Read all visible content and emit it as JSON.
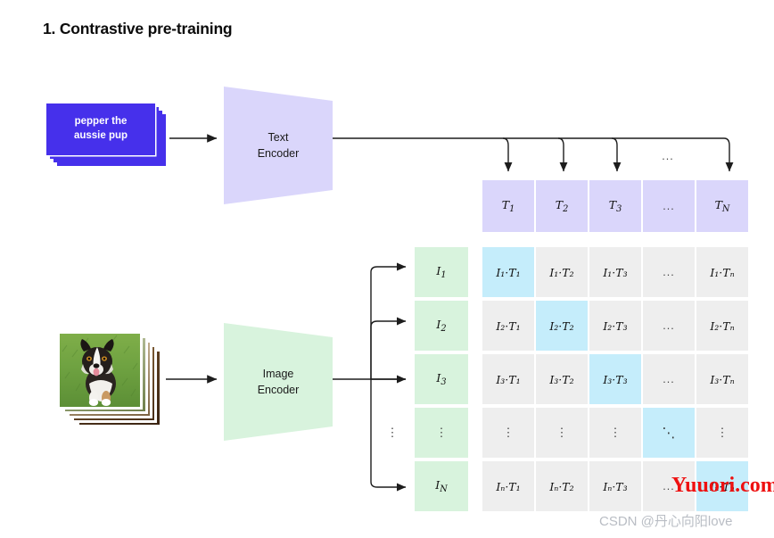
{
  "title": "1. Contrastive pre-training",
  "text_input": {
    "caption": "pepper the\naussie pup",
    "stack_count": 4
  },
  "image_input": {
    "alt": "photo of an aussie pup on grass",
    "stack_count": 5
  },
  "encoders": {
    "text": "Text\nEncoder",
    "image": "Image\nEncoder"
  },
  "text_embeddings": {
    "labels": [
      "T",
      "T",
      "T",
      "",
      "T"
    ],
    "subs": [
      "1",
      "2",
      "3",
      "",
      "N"
    ],
    "ellipsis": "...",
    "bus_ellipsis": "..."
  },
  "image_embeddings": {
    "labels": [
      "I",
      "I",
      "I",
      "",
      "I"
    ],
    "subs": [
      "1",
      "2",
      "3",
      "",
      "N"
    ],
    "ellipsis": "⋮"
  },
  "matrix": {
    "row_labels": [
      "I1",
      "I2",
      "I3",
      "vdots",
      "IN"
    ],
    "col_labels": [
      "T1",
      "T2",
      "T3",
      "dots",
      "TN"
    ],
    "cells": [
      [
        "I₁·T₁",
        "I₁·T₂",
        "I₁·T₃",
        "...",
        "I₁·Tₙ"
      ],
      [
        "I₂·T₁",
        "I₂·T₂",
        "I₂·T₃",
        "...",
        "I₂·Tₙ"
      ],
      [
        "I₃·T₁",
        "I₃·T₂",
        "I₃·T₃",
        "...",
        "I₃·Tₙ"
      ],
      [
        "⋮",
        "⋮",
        "⋮",
        "⋱",
        "⋮"
      ],
      [
        "Iₙ·T₁",
        "Iₙ·T₂",
        "Iₙ·T₃",
        "...",
        "Iₙ·Tₙ"
      ]
    ],
    "diagonal": [
      [
        0,
        0
      ],
      [
        1,
        1
      ],
      [
        2,
        2
      ],
      [
        3,
        3
      ],
      [
        4,
        4
      ]
    ]
  },
  "colors": {
    "text_card": "#4630eb",
    "text_encoder": "#dad6fb",
    "image_encoder": "#d8f3dd",
    "t_head": "#dad6fb",
    "i_head": "#d8f3dd",
    "cell": "#eeeeee",
    "cell_diagonal": "#c5edfb",
    "watermark_red": "#ee1111",
    "watermark_csdn": "#b9bdc4"
  },
  "watermarks": {
    "red": "Yuuori.com",
    "csdn": "CSDN @丹心向阳love"
  }
}
